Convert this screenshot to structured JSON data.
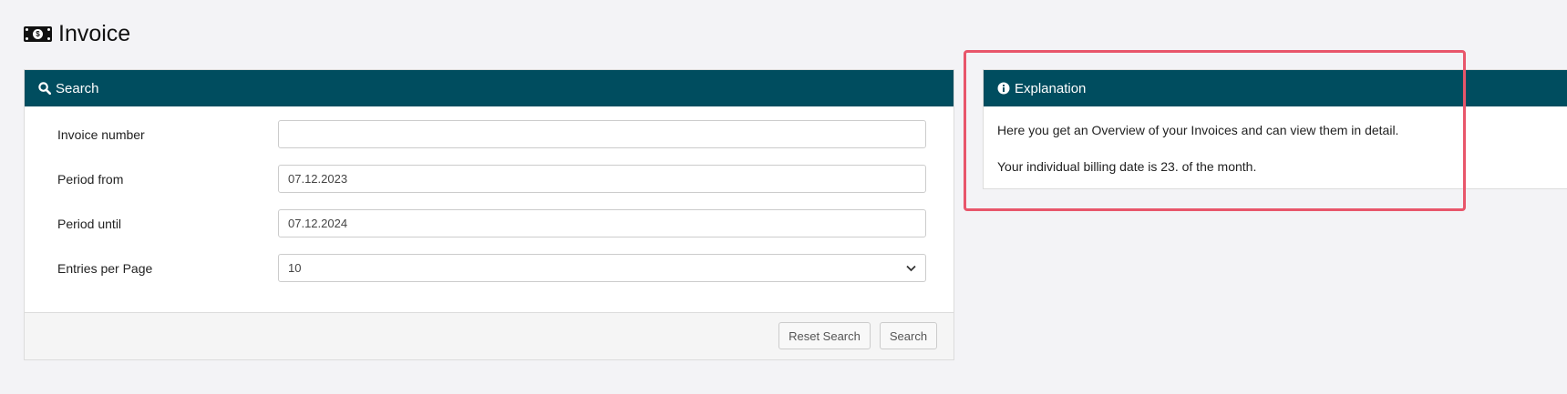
{
  "page": {
    "title": "Invoice",
    "title_icon": "money-bill-icon"
  },
  "search_panel": {
    "heading": "Search",
    "heading_icon": "search-icon",
    "fields": {
      "invoice_number": {
        "label": "Invoice number",
        "value": ""
      },
      "period_from": {
        "label": "Period from",
        "value": "07.12.2023"
      },
      "period_until": {
        "label": "Period until",
        "value": "07.12.2024"
      },
      "entries_per_page": {
        "label": "Entries per Page",
        "value": "10"
      }
    },
    "buttons": {
      "reset": "Reset Search",
      "search": "Search"
    }
  },
  "explanation_panel": {
    "heading": "Explanation",
    "heading_icon": "info-icon",
    "line1": "Here you get an Overview of your Invoices and can view them in detail.",
    "line2": "Your individual billing date is 23. of the month."
  },
  "colors": {
    "panel_header": "#004d5f",
    "highlight": "#e8566b",
    "background": "#f3f3f6"
  }
}
